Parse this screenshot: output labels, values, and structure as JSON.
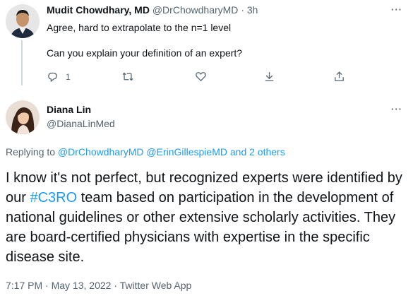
{
  "parent_tweet": {
    "author_name": "Mudit Chowdhary, MD",
    "author_handle": "@DrChowdharyMD",
    "separator": "·",
    "time": "3h",
    "line1": "Agree, hard to extrapolate to the n=1 level",
    "line2": "Can you explain your definition of an expert?",
    "more": "···",
    "actions": {
      "reply_count": "1"
    }
  },
  "main_tweet": {
    "author_name": "Diana Lin",
    "author_handle": "@DianaLinMed",
    "more": "···",
    "replying": {
      "prefix": "Replying to",
      "user1": "@DrChowdharyMD",
      "user2": "@ErinGillespieMD",
      "and": "and",
      "others": "2 others"
    },
    "body": {
      "text_before": "I know it's not perfect, but recognized experts were identified by our",
      "hashtag": "#C3RO",
      "text_after": "team based on participation in the development of national guidelines or other extensive scholarly activities. They are board-certified physicians with expertise in the specific disease site."
    },
    "meta": {
      "time": "7:17 PM",
      "dot1": "·",
      "date": "May 13, 2022",
      "dot2": "·",
      "source": "Twitter Web App"
    }
  },
  "colors": {
    "link": "#1d9bf0",
    "muted": "#536471",
    "text": "#0f1419"
  }
}
